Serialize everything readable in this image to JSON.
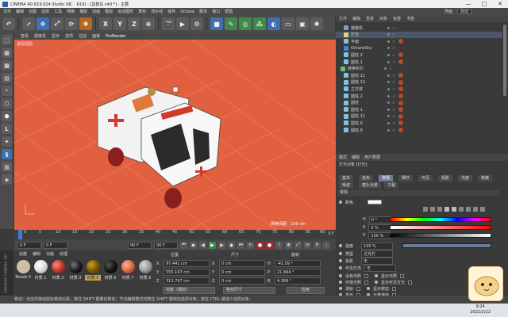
{
  "window": {
    "title": "CINEMA 4D R19.024 Studio (RC - R19) - [急救车.c4d *] - 主要",
    "minimize": "—",
    "maximize": "□",
    "close": "✕"
  },
  "menubar": {
    "items": [
      "文件",
      "编辑",
      "创建",
      "选择",
      "工具",
      "网格",
      "捕捉",
      "动画",
      "模拟",
      "运动图形",
      "角色",
      "流水线",
      "插件",
      "Octane",
      "脚本",
      "窗口",
      "帮助"
    ],
    "layout_label": "界面",
    "layout_value": "启动"
  },
  "toolbar": {
    "undo_icon": "undo-icon",
    "axis_x": "X",
    "axis_y": "Y",
    "axis_z": "Z"
  },
  "viewport": {
    "menu": [
      "查看",
      "摄像机",
      "显示",
      "选项",
      "过滤",
      "面板"
    ],
    "renderer": "ProRender",
    "view_name": "透视视图",
    "grid_spacing": "网格间距：100 cm",
    "background_color": "#e1603f"
  },
  "timeline": {
    "ticks": [
      "0",
      "5",
      "10",
      "15",
      "20",
      "25",
      "30",
      "35",
      "40",
      "45",
      "50",
      "55",
      "60",
      "65",
      "70",
      "75",
      "80",
      "85",
      "90"
    ],
    "end_label": "0 F"
  },
  "playback": {
    "start_frame": "0 F",
    "current_frame": "0 F",
    "end_frame": "90 F",
    "max_frame": "90 F"
  },
  "materials": {
    "menu": [
      "创建",
      "编辑",
      "功能",
      "纹理"
    ],
    "side_label": "MAXON CINEMA 4D",
    "items": [
      {
        "name": "Tweak Mtl",
        "color": "#cdbfa6"
      },
      {
        "name": "材质.1",
        "color": "#dedede"
      },
      {
        "name": "材质.2",
        "color": "#c0392b"
      },
      {
        "name": "材质.3",
        "color": "#1e1e1e"
      },
      {
        "name": "材质.4",
        "color": "#f0f0f0"
      },
      {
        "name": "材质.5",
        "color": "#d4a017"
      },
      {
        "name": "材质.6",
        "color": "#151515"
      },
      {
        "name": "材质.7",
        "color": "#d86a4a"
      },
      {
        "name": "材质.8",
        "color": "#9a9a9a"
      }
    ]
  },
  "coordinates": {
    "headers": {
      "position": "位置",
      "size": "尺寸",
      "rotation": "旋转"
    },
    "rows": [
      {
        "axis": "X",
        "position": "97.441 cm",
        "size": "0 cm",
        "rot_axis": "H",
        "rotation": "-41.09 °"
      },
      {
        "axis": "Y",
        "position": "555.107 cm",
        "size": "0 cm",
        "rot_axis": "P",
        "rotation": "21.844 °"
      },
      {
        "axis": "Z",
        "position": "313.767 cm",
        "size": "0 cm",
        "rot_axis": "B",
        "rotation": "4.369 °"
      }
    ],
    "mode_object": "对象（相对）",
    "mode_size": "绝对尺寸",
    "apply": "应用"
  },
  "object_manager": {
    "menu": [
      "文件",
      "编辑",
      "查看",
      "对象",
      "标签",
      "书签"
    ],
    "objects": [
      {
        "name": "摄像机",
        "color": "#7d9fd6",
        "tag": false,
        "selected": false
      },
      {
        "name": "灯光",
        "color": "#e8d36a",
        "tag": false,
        "selected": true
      },
      {
        "name": "平面",
        "color": "#7ec3e6",
        "tag": true,
        "selected": false
      },
      {
        "name": "OctaneSky",
        "color": "#3a8ed6",
        "tag": false,
        "selected": false
      },
      {
        "name": "圆柱.2",
        "color": "#7ec3e6",
        "tag": true,
        "selected": false
      },
      {
        "name": "圆柱.1",
        "color": "#7ec3e6",
        "tag": true,
        "selected": false
      },
      {
        "name": "转换布尔",
        "color": "#6ac07a",
        "tag": false,
        "selected": false
      },
      {
        "name": "圆柱.11",
        "color": "#7ec3e6",
        "tag": true,
        "selected": false
      },
      {
        "name": "圆柱.13",
        "color": "#7ec3e6",
        "tag": true,
        "selected": false
      },
      {
        "name": "立方体",
        "color": "#7ec3e6",
        "tag": true,
        "selected": false
      },
      {
        "name": "圆柱.2",
        "color": "#7ec3e6",
        "tag": true,
        "selected": false
      },
      {
        "name": "圆柱",
        "color": "#7ec3e6",
        "tag": true,
        "selected": false
      },
      {
        "name": "圆柱.1",
        "color": "#7ec3e6",
        "tag": true,
        "selected": false
      },
      {
        "name": "圆柱.11",
        "color": "#7ec3e6",
        "tag": true,
        "selected": false
      },
      {
        "name": "圆柱.9",
        "color": "#7ec3e6",
        "tag": true,
        "selected": false
      },
      {
        "name": "圆柱.8",
        "color": "#7ec3e6",
        "tag": true,
        "selected": false
      }
    ]
  },
  "attributes": {
    "menu": [
      "模式",
      "编辑",
      "用户数据"
    ],
    "title": "灯光对象 [灯光]",
    "tabs_row1": [
      "基本",
      "坐标",
      "常规",
      "细节",
      "可见",
      "投影",
      "光度",
      "焦散"
    ],
    "tabs_row2": [
      "噪波",
      "镜头光晕",
      "工程"
    ],
    "active_tab": "常规",
    "section": "常规",
    "color_label": "颜色",
    "h_label": "H",
    "h_value": "0 °",
    "s_label": "S",
    "s_value": "0 %",
    "v_label": "V",
    "v_value": "100 %",
    "intensity_label": "强度",
    "intensity_value": "100 %",
    "type_label": "类型",
    "type_value": "泛光灯",
    "shadow_label": "投影",
    "shadow_value": "无",
    "visible_light_label": "可见灯光",
    "visible_light_value": "无",
    "no_illumination": "没有光照",
    "show_illumination": "显示光照",
    "ambient": "环境光照",
    "show_visible": "显示可见灯光",
    "diffuse": "漫射",
    "show_clipping": "显示修剪",
    "specular": "高光",
    "separate_pass": "分离通道",
    "light_color": "#ffffff"
  },
  "status_bar": {
    "text": "移动：点击并拖动鼠标移动元素。按住 SHIFT 键量化移动；节点编辑模式时按住 SHIFT 键增加选择对象；按住 CTRL 键减少选择对象。"
  },
  "taskbar": {
    "time": "9:24",
    "date": "2022/2/22"
  }
}
